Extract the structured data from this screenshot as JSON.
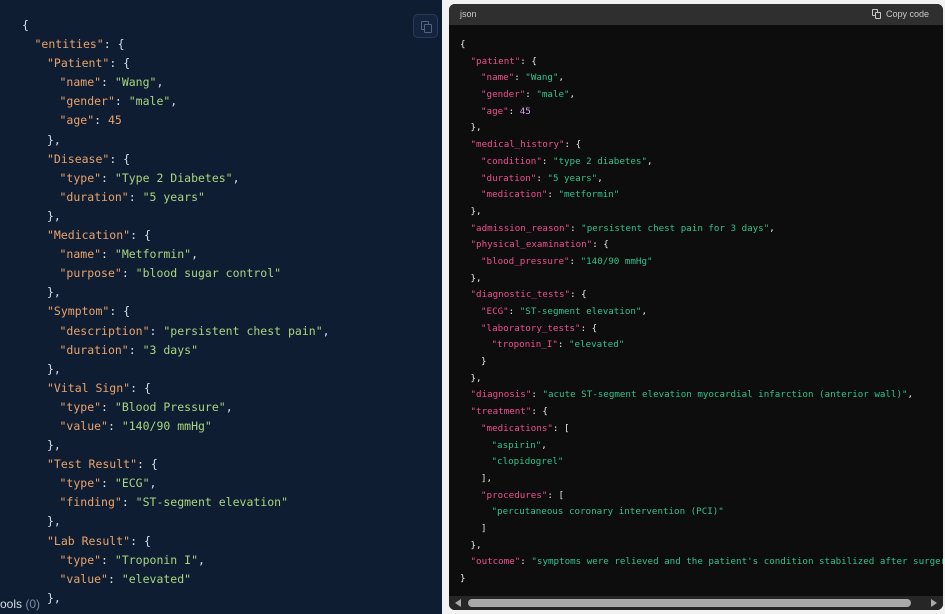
{
  "left_panel": {
    "footer_label": "ools",
    "footer_count": "(0)",
    "lines": [
      {
        "indent": 2,
        "tokens": [
          [
            "p",
            "{"
          ]
        ]
      },
      {
        "indent": 3,
        "tokens": [
          [
            "k",
            "\"entities\""
          ],
          [
            "p",
            ": {"
          ]
        ]
      },
      {
        "indent": 4,
        "tokens": [
          [
            "k",
            "\"Patient\""
          ],
          [
            "p",
            ": {"
          ]
        ]
      },
      {
        "indent": 5,
        "tokens": [
          [
            "k",
            "\"name\""
          ],
          [
            "p",
            ": "
          ],
          [
            "s",
            "\"Wang\""
          ],
          [
            "p",
            ","
          ]
        ]
      },
      {
        "indent": 5,
        "tokens": [
          [
            "k",
            "\"gender\""
          ],
          [
            "p",
            ": "
          ],
          [
            "s",
            "\"male\""
          ],
          [
            "p",
            ","
          ]
        ]
      },
      {
        "indent": 5,
        "tokens": [
          [
            "k",
            "\"age\""
          ],
          [
            "p",
            ": "
          ],
          [
            "n",
            "45"
          ]
        ]
      },
      {
        "indent": 4,
        "tokens": [
          [
            "p",
            "},"
          ]
        ]
      },
      {
        "indent": 4,
        "tokens": [
          [
            "k",
            "\"Disease\""
          ],
          [
            "p",
            ": {"
          ]
        ]
      },
      {
        "indent": 5,
        "tokens": [
          [
            "k",
            "\"type\""
          ],
          [
            "p",
            ": "
          ],
          [
            "s",
            "\"Type 2 Diabetes\""
          ],
          [
            "p",
            ","
          ]
        ]
      },
      {
        "indent": 5,
        "tokens": [
          [
            "k",
            "\"duration\""
          ],
          [
            "p",
            ": "
          ],
          [
            "s",
            "\"5 years\""
          ]
        ]
      },
      {
        "indent": 4,
        "tokens": [
          [
            "p",
            "},"
          ]
        ]
      },
      {
        "indent": 4,
        "tokens": [
          [
            "k",
            "\"Medication\""
          ],
          [
            "p",
            ": {"
          ]
        ]
      },
      {
        "indent": 5,
        "tokens": [
          [
            "k",
            "\"name\""
          ],
          [
            "p",
            ": "
          ],
          [
            "s",
            "\"Metformin\""
          ],
          [
            "p",
            ","
          ]
        ]
      },
      {
        "indent": 5,
        "tokens": [
          [
            "k",
            "\"purpose\""
          ],
          [
            "p",
            ": "
          ],
          [
            "s",
            "\"blood sugar control\""
          ]
        ]
      },
      {
        "indent": 4,
        "tokens": [
          [
            "p",
            "},"
          ]
        ]
      },
      {
        "indent": 4,
        "tokens": [
          [
            "k",
            "\"Symptom\""
          ],
          [
            "p",
            ": {"
          ]
        ]
      },
      {
        "indent": 5,
        "tokens": [
          [
            "k",
            "\"description\""
          ],
          [
            "p",
            ": "
          ],
          [
            "s",
            "\"persistent chest pain\""
          ],
          [
            "p",
            ","
          ]
        ]
      },
      {
        "indent": 5,
        "tokens": [
          [
            "k",
            "\"duration\""
          ],
          [
            "p",
            ": "
          ],
          [
            "s",
            "\"3 days\""
          ]
        ]
      },
      {
        "indent": 4,
        "tokens": [
          [
            "p",
            "},"
          ]
        ]
      },
      {
        "indent": 4,
        "tokens": [
          [
            "k",
            "\"Vital Sign\""
          ],
          [
            "p",
            ": {"
          ]
        ]
      },
      {
        "indent": 5,
        "tokens": [
          [
            "k",
            "\"type\""
          ],
          [
            "p",
            ": "
          ],
          [
            "s",
            "\"Blood Pressure\""
          ],
          [
            "p",
            ","
          ]
        ]
      },
      {
        "indent": 5,
        "tokens": [
          [
            "k",
            "\"value\""
          ],
          [
            "p",
            ": "
          ],
          [
            "s",
            "\"140/90 mmHg\""
          ]
        ]
      },
      {
        "indent": 4,
        "tokens": [
          [
            "p",
            "},"
          ]
        ]
      },
      {
        "indent": 4,
        "tokens": [
          [
            "k",
            "\"Test Result\""
          ],
          [
            "p",
            ": {"
          ]
        ]
      },
      {
        "indent": 5,
        "tokens": [
          [
            "k",
            "\"type\""
          ],
          [
            "p",
            ": "
          ],
          [
            "s",
            "\"ECG\""
          ],
          [
            "p",
            ","
          ]
        ]
      },
      {
        "indent": 5,
        "tokens": [
          [
            "k",
            "\"finding\""
          ],
          [
            "p",
            ": "
          ],
          [
            "s",
            "\"ST-segment elevation\""
          ]
        ]
      },
      {
        "indent": 4,
        "tokens": [
          [
            "p",
            "},"
          ]
        ]
      },
      {
        "indent": 4,
        "tokens": [
          [
            "k",
            "\"Lab Result\""
          ],
          [
            "p",
            ": {"
          ]
        ]
      },
      {
        "indent": 5,
        "tokens": [
          [
            "k",
            "\"type\""
          ],
          [
            "p",
            ": "
          ],
          [
            "s",
            "\"Troponin I\""
          ],
          [
            "p",
            ","
          ]
        ]
      },
      {
        "indent": 5,
        "tokens": [
          [
            "k",
            "\"value\""
          ],
          [
            "p",
            ": "
          ],
          [
            "s",
            "\"elevated\""
          ]
        ]
      },
      {
        "indent": 4,
        "tokens": [
          [
            "p",
            "},"
          ]
        ]
      }
    ]
  },
  "right_panel": {
    "language": "json",
    "copy_label": "Copy code",
    "lines": [
      {
        "indent": 0,
        "tokens": [
          [
            "p",
            "{"
          ]
        ]
      },
      {
        "indent": 1,
        "tokens": [
          [
            "k",
            "\"patient\""
          ],
          [
            "p",
            ": {"
          ]
        ]
      },
      {
        "indent": 2,
        "tokens": [
          [
            "k",
            "\"name\""
          ],
          [
            "p",
            ": "
          ],
          [
            "s",
            "\"Wang\""
          ],
          [
            "p",
            ","
          ]
        ]
      },
      {
        "indent": 2,
        "tokens": [
          [
            "k",
            "\"gender\""
          ],
          [
            "p",
            ": "
          ],
          [
            "s",
            "\"male\""
          ],
          [
            "p",
            ","
          ]
        ]
      },
      {
        "indent": 2,
        "tokens": [
          [
            "k",
            "\"age\""
          ],
          [
            "p",
            ": "
          ],
          [
            "n",
            "45"
          ]
        ]
      },
      {
        "indent": 1,
        "tokens": [
          [
            "p",
            "},"
          ]
        ]
      },
      {
        "indent": 1,
        "tokens": [
          [
            "k",
            "\"medical_history\""
          ],
          [
            "p",
            ": {"
          ]
        ]
      },
      {
        "indent": 2,
        "tokens": [
          [
            "k",
            "\"condition\""
          ],
          [
            "p",
            ": "
          ],
          [
            "s",
            "\"type 2 diabetes\""
          ],
          [
            "p",
            ","
          ]
        ]
      },
      {
        "indent": 2,
        "tokens": [
          [
            "k",
            "\"duration\""
          ],
          [
            "p",
            ": "
          ],
          [
            "s",
            "\"5 years\""
          ],
          [
            "p",
            ","
          ]
        ]
      },
      {
        "indent": 2,
        "tokens": [
          [
            "k",
            "\"medication\""
          ],
          [
            "p",
            ": "
          ],
          [
            "s",
            "\"metformin\""
          ]
        ]
      },
      {
        "indent": 1,
        "tokens": [
          [
            "p",
            "},"
          ]
        ]
      },
      {
        "indent": 1,
        "tokens": [
          [
            "k",
            "\"admission_reason\""
          ],
          [
            "p",
            ": "
          ],
          [
            "s",
            "\"persistent chest pain for 3 days\""
          ],
          [
            "p",
            ","
          ]
        ]
      },
      {
        "indent": 1,
        "tokens": [
          [
            "k",
            "\"physical_examination\""
          ],
          [
            "p",
            ": {"
          ]
        ]
      },
      {
        "indent": 2,
        "tokens": [
          [
            "k",
            "\"blood_pressure\""
          ],
          [
            "p",
            ": "
          ],
          [
            "s",
            "\"140/90 mmHg\""
          ]
        ]
      },
      {
        "indent": 1,
        "tokens": [
          [
            "p",
            "},"
          ]
        ]
      },
      {
        "indent": 1,
        "tokens": [
          [
            "k",
            "\"diagnostic_tests\""
          ],
          [
            "p",
            ": {"
          ]
        ]
      },
      {
        "indent": 2,
        "tokens": [
          [
            "k",
            "\"ECG\""
          ],
          [
            "p",
            ": "
          ],
          [
            "s",
            "\"ST-segment elevation\""
          ],
          [
            "p",
            ","
          ]
        ]
      },
      {
        "indent": 2,
        "tokens": [
          [
            "k",
            "\"laboratory_tests\""
          ],
          [
            "p",
            ": {"
          ]
        ]
      },
      {
        "indent": 3,
        "tokens": [
          [
            "k",
            "\"troponin_I\""
          ],
          [
            "p",
            ": "
          ],
          [
            "s",
            "\"elevated\""
          ]
        ]
      },
      {
        "indent": 2,
        "tokens": [
          [
            "p",
            "}"
          ]
        ]
      },
      {
        "indent": 1,
        "tokens": [
          [
            "p",
            "},"
          ]
        ]
      },
      {
        "indent": 1,
        "tokens": [
          [
            "k",
            "\"diagnosis\""
          ],
          [
            "p",
            ": "
          ],
          [
            "s",
            "\"acute ST-segment elevation myocardial infarction (anterior wall)\""
          ],
          [
            "p",
            ","
          ]
        ]
      },
      {
        "indent": 1,
        "tokens": [
          [
            "k",
            "\"treatment\""
          ],
          [
            "p",
            ": {"
          ]
        ]
      },
      {
        "indent": 2,
        "tokens": [
          [
            "k",
            "\"medications\""
          ],
          [
            "p",
            ": ["
          ]
        ]
      },
      {
        "indent": 3,
        "tokens": [
          [
            "s",
            "\"aspirin\""
          ],
          [
            "p",
            ","
          ]
        ]
      },
      {
        "indent": 3,
        "tokens": [
          [
            "s",
            "\"clopidogrel\""
          ]
        ]
      },
      {
        "indent": 2,
        "tokens": [
          [
            "p",
            "],"
          ]
        ]
      },
      {
        "indent": 2,
        "tokens": [
          [
            "k",
            "\"procedures\""
          ],
          [
            "p",
            ": ["
          ]
        ]
      },
      {
        "indent": 3,
        "tokens": [
          [
            "s",
            "\"percutaneous coronary intervention (PCI)\""
          ]
        ]
      },
      {
        "indent": 2,
        "tokens": [
          [
            "p",
            "]"
          ]
        ]
      },
      {
        "indent": 1,
        "tokens": [
          [
            "p",
            "},"
          ]
        ]
      },
      {
        "indent": 1,
        "tokens": [
          [
            "k",
            "\"outcome\""
          ],
          [
            "p",
            ": "
          ],
          [
            "s",
            "\"symptoms were relieved and the patient's condition stabilized after surgery\""
          ]
        ]
      },
      {
        "indent": 0,
        "tokens": [
          [
            "p",
            "}"
          ]
        ]
      }
    ]
  }
}
